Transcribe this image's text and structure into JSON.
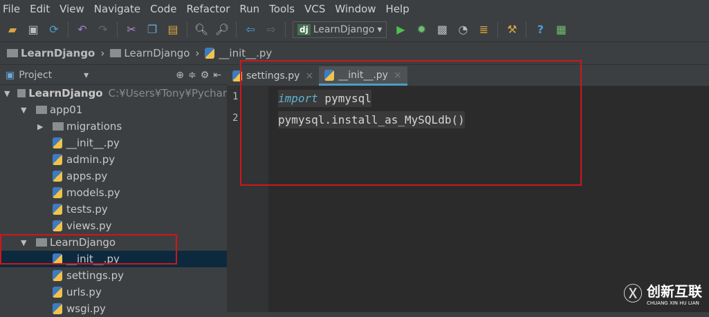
{
  "menu": [
    "File",
    "Edit",
    "View",
    "Navigate",
    "Code",
    "Refactor",
    "Run",
    "Tools",
    "VCS",
    "Window",
    "Help"
  ],
  "toolbar": {
    "run_config": "LearnDjango",
    "run_config_badge": "dj"
  },
  "breadcrumb": [
    "LearnDjango",
    "LearnDjango",
    "__init__.py"
  ],
  "project_panel": {
    "title": "Project",
    "root": {
      "name": "LearnDjango",
      "path": "C:¥Users¥Tony¥Pychar"
    },
    "items": [
      {
        "name": "app01",
        "kind": "folder",
        "level": 1,
        "expanded": true
      },
      {
        "name": "migrations",
        "kind": "folder",
        "level": 2,
        "expanded": false
      },
      {
        "name": "__init__.py",
        "kind": "py",
        "level": 2
      },
      {
        "name": "admin.py",
        "kind": "py",
        "level": 2
      },
      {
        "name": "apps.py",
        "kind": "py",
        "level": 2
      },
      {
        "name": "models.py",
        "kind": "py",
        "level": 2
      },
      {
        "name": "tests.py",
        "kind": "py",
        "level": 2
      },
      {
        "name": "views.py",
        "kind": "py",
        "level": 2
      },
      {
        "name": "LearnDjango",
        "kind": "folder",
        "level": 1,
        "expanded": true
      },
      {
        "name": "__init__.py",
        "kind": "py",
        "level": 2,
        "selected": true
      },
      {
        "name": "settings.py",
        "kind": "py",
        "level": 2
      },
      {
        "name": "urls.py",
        "kind": "py",
        "level": 2
      },
      {
        "name": "wsgi.py",
        "kind": "py",
        "level": 2
      }
    ]
  },
  "tabs": [
    {
      "label": "settings.py",
      "active": false
    },
    {
      "label": "__init__.py",
      "active": true
    }
  ],
  "code": {
    "line1_kw": "import",
    "line1_rest": " pymysql",
    "line2": "pymysql.install_as_MySQLdb()",
    "line_numbers": [
      "1",
      "2"
    ]
  },
  "watermark": {
    "text": "创新互联",
    "sub": "CHUANG XIN HU LIAN"
  },
  "colors": {
    "highlight": "#d0161b",
    "accent": "#4a9fc9",
    "keyword": "#5fb3d1"
  }
}
